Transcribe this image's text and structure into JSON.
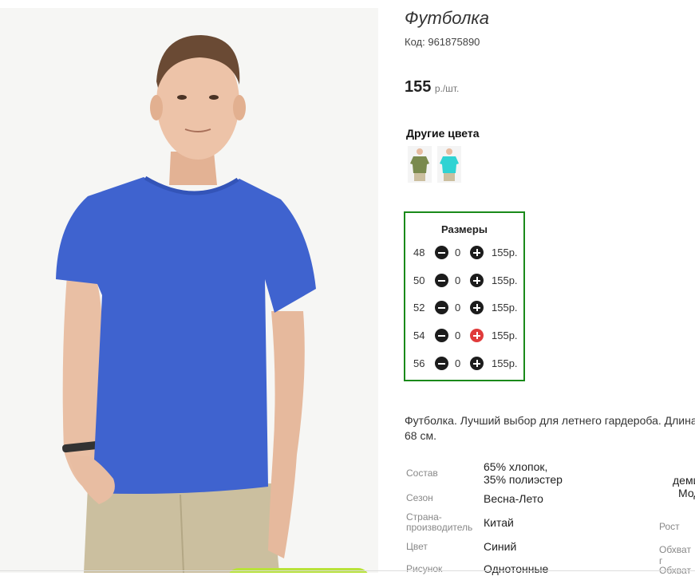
{
  "product": {
    "title": "Футболка",
    "code_label": "Код:",
    "code": "961875890",
    "price": "155",
    "price_unit": "р./шт."
  },
  "other_colors": {
    "title": "Другие цвета",
    "swatches": [
      {
        "color_name": "olive",
        "shirt_color": "#7a8a4e"
      },
      {
        "color_name": "turquoise",
        "shirt_color": "#2fd3d3"
      }
    ]
  },
  "sizes": {
    "title": "Размеры",
    "rows": [
      {
        "size": "48",
        "qty": "0",
        "price": "155р."
      },
      {
        "size": "50",
        "qty": "0",
        "price": "155р."
      },
      {
        "size": "52",
        "qty": "0",
        "price": "155р."
      },
      {
        "size": "54",
        "qty": "0",
        "price": "155р."
      },
      {
        "size": "56",
        "qty": "0",
        "price": "155р."
      }
    ]
  },
  "description": {
    "line1": "Футболка. Лучший выбор для летнего гардероба. Длина",
    "line2": "68 см."
  },
  "attributes": {
    "composition_label": "Состав",
    "composition_line1": "65% хлопок,",
    "composition_line2": "35% полиэстер",
    "season_label": "Сезон",
    "season": "Весна-Лето",
    "country_label_line1": "Страна-",
    "country_label_line2": "производитель",
    "country": "Китай",
    "color_label": "Цвет",
    "color": "Синий",
    "pattern_label": "Рисунок",
    "pattern": "Однотонные"
  },
  "right_attributes": {
    "value1": "деми",
    "value2": "Мод",
    "height_label": "Рост",
    "chest_label": "Обхват г",
    "third_label": "Обхват"
  },
  "colors": {
    "shirt": "#3f63cf",
    "sizes_border": "#1a8a1a",
    "plus_highlight": "#e03b3b",
    "buy_button": "#b8e23a"
  },
  "icons": {
    "minus": "minus-circle-icon",
    "plus": "plus-circle-icon"
  }
}
